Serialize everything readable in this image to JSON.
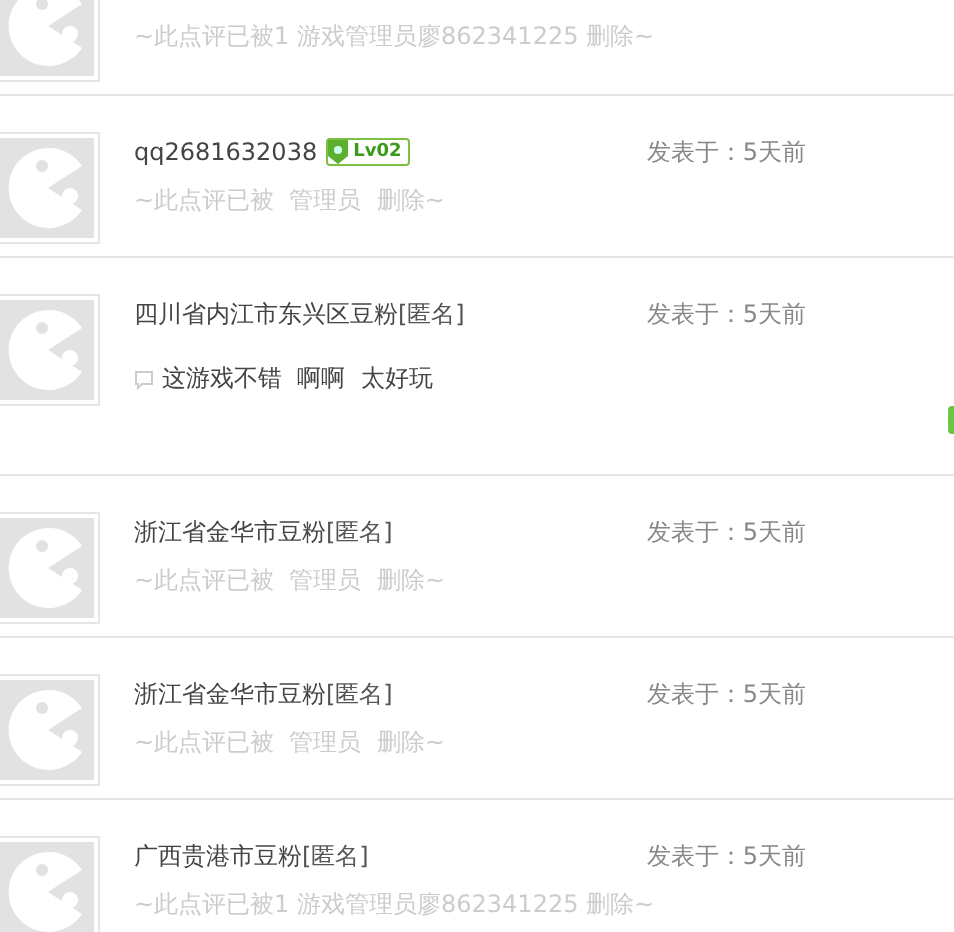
{
  "comments": [
    {
      "kind": "notice",
      "notice": "~此点评已被1 游戏管理员廖862341225 删除~"
    },
    {
      "kind": "notice",
      "author": "qq2681632038",
      "badge": "Lv02",
      "posted_label": "发表于：",
      "time": "5天前",
      "notice": "~此点评已被  管理员  删除~"
    },
    {
      "kind": "comment",
      "author": "四川省内江市东兴区豆粉",
      "tag": "[匿名]",
      "posted_label": "发表于：",
      "time": "5天前",
      "text": "这游戏不错  啊啊  太好玩"
    },
    {
      "kind": "notice",
      "author": "浙江省金华市豆粉",
      "tag": "[匿名]",
      "posted_label": "发表于：",
      "time": "5天前",
      "notice": "~此点评已被  管理员  删除~"
    },
    {
      "kind": "notice",
      "author": "浙江省金华市豆粉",
      "tag": "[匿名]",
      "posted_label": "发表于：",
      "time": "5天前",
      "notice": "~此点评已被  管理员  删除~"
    },
    {
      "kind": "notice",
      "author": "广西贵港市豆粉",
      "tag": "[匿名]",
      "posted_label": "发表于：",
      "time": "5天前",
      "notice": "~此点评已被1 游戏管理员廖862341225 删除~"
    }
  ]
}
